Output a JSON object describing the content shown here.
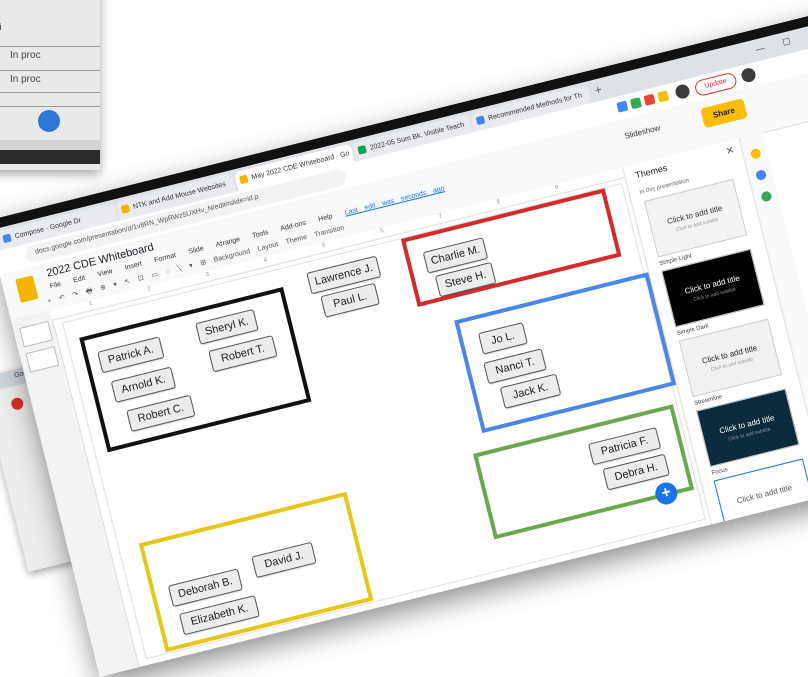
{
  "background_sheet": {
    "left_label": "ulti",
    "rows": [
      "In proc",
      "In proc"
    ]
  },
  "background_window2": {
    "tab_label": "Google Dr"
  },
  "browser": {
    "tabs": [
      {
        "label": "Compose · Google Dr",
        "color": "#4285f4"
      },
      {
        "label": "NTK and Add Mouse Websites",
        "color": "#f4b400"
      },
      {
        "label": "May 2022 CDE Whiteboard · Go",
        "color": "#f4b400"
      },
      {
        "label": "2022-05 Sum Bk, Visible Teach",
        "color": "#0f9d58"
      },
      {
        "label": "Recommended Methods for Th",
        "color": "#4285f4"
      }
    ],
    "new_tab": "+",
    "url": "docs.google.com/presentation/d/1v8RN_WpRWz5UXHv_N/edit#slide=id.p",
    "update_label": "Update",
    "window_controls": "— ☐ ✕"
  },
  "app": {
    "doc_title": "2022 CDE Whiteboard",
    "menu": [
      "File",
      "Edit",
      "View",
      "Insert",
      "Format",
      "Slide",
      "Arrange",
      "Tools",
      "Add-ons",
      "Help"
    ],
    "last_edit": "Last edit was seconds ago",
    "toolbar": [
      "+",
      "↶",
      "↷",
      "🖶",
      "⊕",
      "▾",
      "↖",
      "⊡",
      "▭",
      "◌",
      "╲",
      "▾",
      "⊞",
      "Background",
      "Layout",
      "Theme",
      "Transition"
    ],
    "slideshow_label": "Slideshow",
    "share_label": "Share"
  },
  "ruler_ticks": [
    "1",
    "2",
    "3",
    "4",
    "5",
    "6",
    "7",
    "8",
    "9"
  ],
  "whiteboard": {
    "groups": [
      {
        "name": "black-group",
        "color": "#111111",
        "chips": [
          "Patrick A.",
          "Sheryl K.",
          "Arnold K.",
          "Robert T.",
          "Robert C."
        ]
      },
      {
        "name": "red-group",
        "color": "#d62a2a",
        "chips": [
          "Charlie M.",
          "Steve H."
        ]
      },
      {
        "name": "blue-group",
        "color": "#4a86e8",
        "chips": [
          "Jo L.",
          "Nanci T.",
          "Jack K."
        ]
      },
      {
        "name": "green-group",
        "color": "#6aa84f",
        "chips": [
          "Patricia F.",
          "Debra H."
        ]
      },
      {
        "name": "yellow-group",
        "color": "#e6c619",
        "chips": [
          "Deborah B.",
          "David J.",
          "Elizabeth K."
        ]
      }
    ],
    "ungrouped_chips": [
      "Lawrence J.",
      "Paul L."
    ]
  },
  "themes": {
    "header": "Themes",
    "close": "✕",
    "in_presentation": "In this presentation",
    "cards": [
      {
        "name": "",
        "title": "Click to add title",
        "subtitle": "Click to add subtitle",
        "bg": "#f3f3f3",
        "fg": "#333333"
      },
      {
        "name": "Simple Light",
        "title": "Click to add title",
        "subtitle": "Click to add subtitle",
        "bg": "#000000",
        "fg": "#ffffff"
      },
      {
        "name": "Simple Dark",
        "title": "Click to add title",
        "subtitle": "Click to add subtitle",
        "bg": "#f1f1f1",
        "fg": "#222222"
      },
      {
        "name": "Streamline",
        "title": "Click to add title",
        "subtitle": "Click to add subtitle",
        "bg": "#0b2a3c",
        "fg": "#ffffff"
      },
      {
        "name": "Focus",
        "title": "Click to add title",
        "subtitle": "",
        "bg": "#ffffff",
        "fg": "#555555"
      }
    ]
  }
}
